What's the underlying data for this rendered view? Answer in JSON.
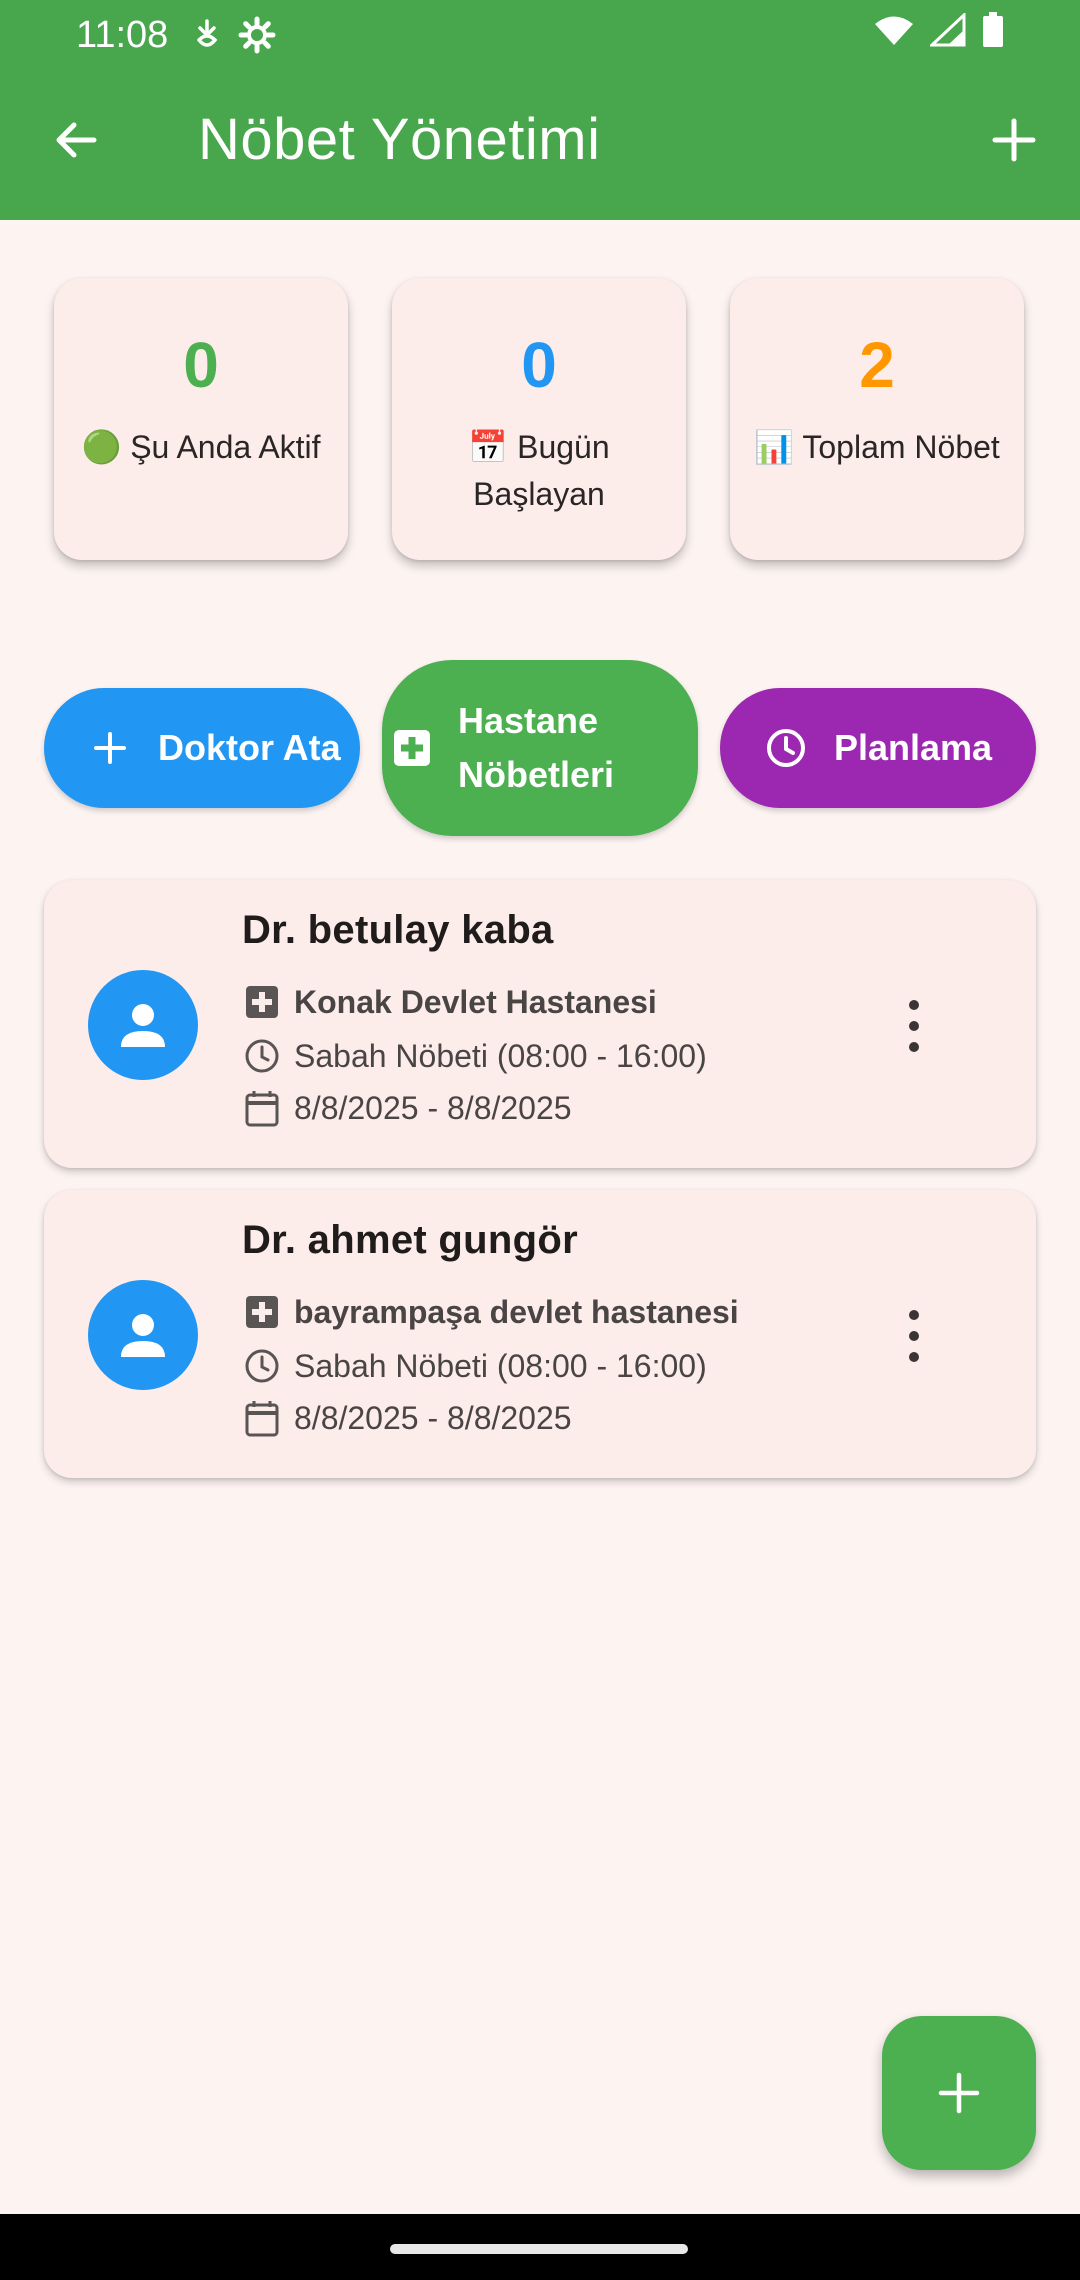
{
  "status_bar": {
    "time": "11:08",
    "icons": [
      "data-saver-icon",
      "settings-gear-icon"
    ],
    "right_icons": [
      "wifi-icon",
      "signal-icon",
      "battery-icon"
    ]
  },
  "app_bar": {
    "title": "Nöbet Yönetimi",
    "back_icon": "arrow-back-icon",
    "add_icon": "plus-icon",
    "background": "#48a64c"
  },
  "stats": [
    {
      "value": "0",
      "label": "🟢 Şu Anda Aktif",
      "color": "#4caf50"
    },
    {
      "value": "0",
      "label": "📅 Bugün Başlayan",
      "color": "#2296f3"
    },
    {
      "value": "2",
      "label": "📊 Toplam Nöbet",
      "color": "#ff9800"
    }
  ],
  "actions": [
    {
      "label": "Doktor Ata",
      "icon": "plus-icon",
      "color": "#2296f3"
    },
    {
      "label": "Hastane Nöbetleri",
      "icon": "hospital-icon",
      "color": "#4caf50"
    },
    {
      "label": "Planlama",
      "icon": "clock-icon",
      "color": "#9c27b0"
    }
  ],
  "duties": [
    {
      "doctor": "Dr. betulay kaba",
      "hospital": "Konak Devlet Hastanesi",
      "shift": "Sabah Nöbeti (08:00 - 16:00)",
      "dates": "8/8/2025 - 8/8/2025"
    },
    {
      "doctor": "Dr. ahmet gungör",
      "hospital": "bayrampaşa devlet hastanesi",
      "shift": "Sabah Nöbeti (08:00 - 16:00)",
      "dates": "8/8/2025 - 8/8/2025"
    }
  ],
  "fab": {
    "icon": "plus-icon",
    "color": "#4caf50"
  }
}
